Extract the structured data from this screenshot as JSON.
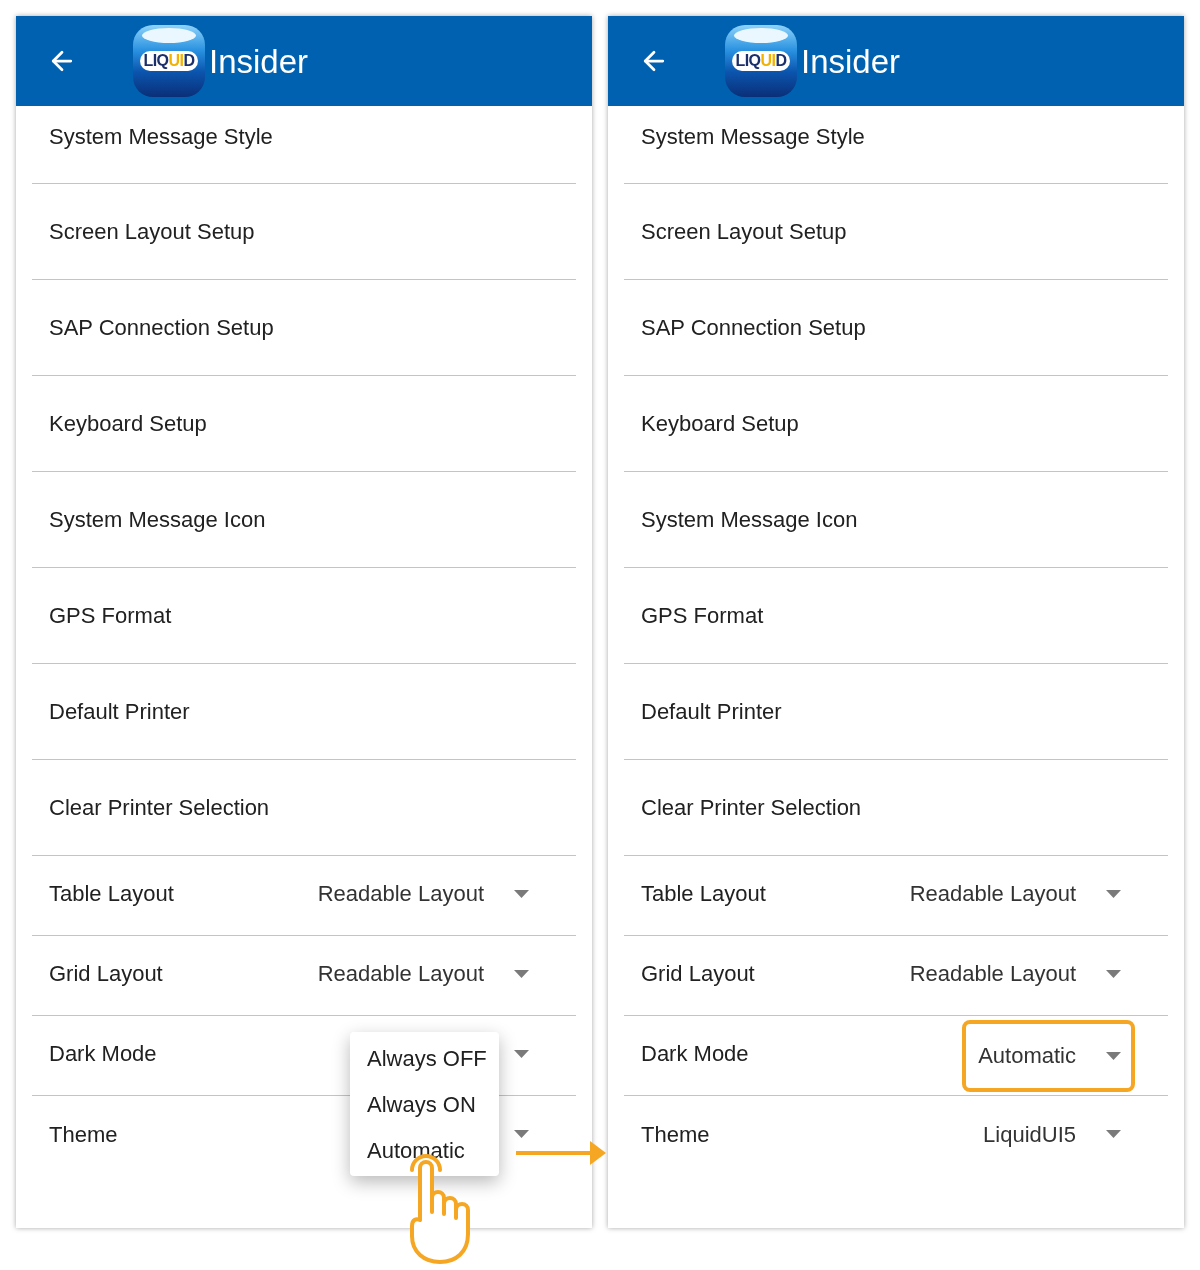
{
  "panels": [
    {
      "header": {
        "logo": {
          "parts": [
            {
              "text": "LIQ",
              "color": "#1b2f6b"
            },
            {
              "text": "UI",
              "color": "#f2b200"
            },
            {
              "text": "D",
              "color": "#1b2f6b"
            }
          ]
        },
        "title": "Insider"
      },
      "settings": [
        {
          "kind": "item",
          "label": "System Message Style"
        },
        {
          "kind": "item",
          "label": "Screen Layout Setup"
        },
        {
          "kind": "item",
          "label": "SAP Connection Setup"
        },
        {
          "kind": "item",
          "label": "Keyboard Setup"
        },
        {
          "kind": "item",
          "label": "System Message Icon"
        },
        {
          "kind": "item",
          "label": "GPS Format"
        },
        {
          "kind": "item",
          "label": "Default Printer"
        },
        {
          "kind": "item",
          "label": "Clear Printer Selection"
        },
        {
          "kind": "dropdown",
          "label": "Table Layout",
          "value": "Readable Layout",
          "highlighted": false
        },
        {
          "kind": "dropdown",
          "label": "Grid Layout",
          "value": "Readable Layout",
          "highlighted": false
        },
        {
          "kind": "dropdown",
          "label": "Dark Mode",
          "highlighted": false
        },
        {
          "kind": "dropdown",
          "label": "Theme",
          "highlighted": false
        }
      ],
      "menu": {
        "options": [
          {
            "label": "Always OFF",
            "selected": false
          },
          {
            "label": "Always ON",
            "selected": false
          },
          {
            "label": "Automatic",
            "selected": true
          }
        ]
      }
    },
    {
      "header": {
        "logo": {
          "parts": [
            {
              "text": "LIQ",
              "color": "#1b2f6b"
            },
            {
              "text": "UI",
              "color": "#f2b200"
            },
            {
              "text": "D",
              "color": "#1b2f6b"
            }
          ]
        },
        "title": "Insider"
      },
      "settings": [
        {
          "kind": "item",
          "label": "System Message Style"
        },
        {
          "kind": "item",
          "label": "Screen Layout Setup"
        },
        {
          "kind": "item",
          "label": "SAP Connection Setup"
        },
        {
          "kind": "item",
          "label": "Keyboard Setup"
        },
        {
          "kind": "item",
          "label": "System Message Icon"
        },
        {
          "kind": "item",
          "label": "GPS Format"
        },
        {
          "kind": "item",
          "label": "Default Printer"
        },
        {
          "kind": "item",
          "label": "Clear Printer Selection"
        },
        {
          "kind": "dropdown",
          "label": "Table Layout",
          "value": "Readable Layout",
          "highlighted": false
        },
        {
          "kind": "dropdown",
          "label": "Grid Layout",
          "value": "Readable Layout",
          "highlighted": false
        },
        {
          "kind": "dropdown",
          "label": "Dark Mode",
          "value": "Automatic",
          "highlighted": true
        },
        {
          "kind": "dropdown",
          "label": "Theme",
          "value": "LiquidUI5",
          "highlighted": false
        }
      ]
    }
  ]
}
